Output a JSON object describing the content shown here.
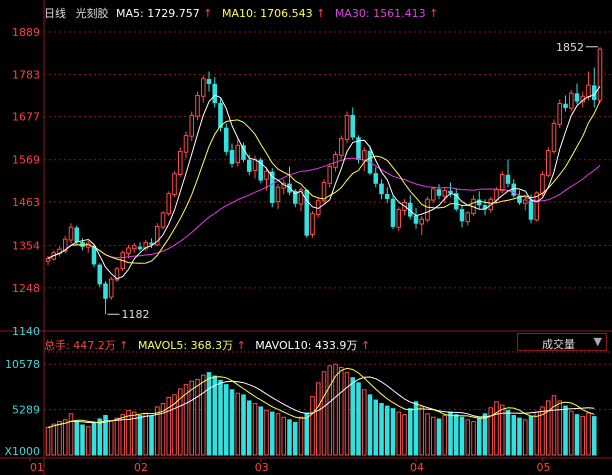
{
  "header": {
    "period": "日线",
    "name": "光刻胶",
    "ma5_label": "MA5:",
    "ma5_value": "1729.757",
    "ma10_label": "MA10:",
    "ma10_value": "1706.543",
    "ma30_label": "MA30:",
    "ma30_value": "1561.413",
    "up_arrow": "↑"
  },
  "volume_header": {
    "total_label": "总手:",
    "total_value": "447.2万",
    "mavol5_label": "MAVOL5:",
    "mavol5_value": "368.3万",
    "mavol10_label": "MAVOL10:",
    "mavol10_value": "433.9万",
    "up_arrow": "↑"
  },
  "indicator_select": {
    "selected": "成交量",
    "icon": "triangle-down-icon"
  },
  "colors": {
    "up": "#ff4a4a",
    "down": "#33e0e0",
    "ma5": "#ffffff",
    "ma10": "#ffff55",
    "ma30": "#e040e0",
    "axis": "#8b1a1a",
    "label_up": "#ff4040",
    "label_down": "#40d8d8"
  },
  "chart_data": [
    {
      "type": "candlestick",
      "title": "光刻胶",
      "x_ticks": [
        "01",
        "02",
        "03",
        "04",
        "05"
      ],
      "y_ticks": [
        "1140",
        "1248",
        "1354",
        "1463",
        "1569",
        "1677",
        "1783",
        "1889"
      ],
      "ylim": [
        1140,
        1889
      ],
      "annotations": [
        {
          "label": "1852"
        },
        {
          "label": "1182"
        }
      ],
      "series": [
        {
          "name": "MA5"
        },
        {
          "name": "MA10"
        },
        {
          "name": "MA30"
        }
      ],
      "candles": [
        [
          1315,
          1328,
          1305,
          1322
        ],
        [
          1320,
          1342,
          1316,
          1336
        ],
        [
          1334,
          1352,
          1326,
          1345
        ],
        [
          1340,
          1378,
          1334,
          1370
        ],
        [
          1368,
          1410,
          1360,
          1400
        ],
        [
          1398,
          1404,
          1358,
          1364
        ],
        [
          1362,
          1372,
          1342,
          1352
        ],
        [
          1350,
          1366,
          1336,
          1360
        ],
        [
          1352,
          1358,
          1300,
          1308
        ],
        [
          1305,
          1310,
          1250,
          1258
        ],
        [
          1258,
          1265,
          1182,
          1222
        ],
        [
          1225,
          1276,
          1218,
          1270
        ],
        [
          1268,
          1300,
          1262,
          1296
        ],
        [
          1296,
          1342,
          1290,
          1336
        ],
        [
          1334,
          1356,
          1322,
          1348
        ],
        [
          1346,
          1360,
          1336,
          1354
        ],
        [
          1350,
          1362,
          1340,
          1346
        ],
        [
          1346,
          1368,
          1340,
          1362
        ],
        [
          1360,
          1372,
          1348,
          1358
        ],
        [
          1356,
          1410,
          1352,
          1402
        ],
        [
          1400,
          1440,
          1394,
          1436
        ],
        [
          1434,
          1490,
          1428,
          1484
        ],
        [
          1482,
          1540,
          1476,
          1534
        ],
        [
          1532,
          1600,
          1526,
          1590
        ],
        [
          1588,
          1640,
          1572,
          1630
        ],
        [
          1628,
          1690,
          1616,
          1680
        ],
        [
          1678,
          1740,
          1668,
          1730
        ],
        [
          1728,
          1780,
          1712,
          1772
        ],
        [
          1770,
          1790,
          1740,
          1760
        ],
        [
          1758,
          1776,
          1700,
          1712
        ],
        [
          1710,
          1722,
          1640,
          1650
        ],
        [
          1648,
          1660,
          1580,
          1590
        ],
        [
          1592,
          1610,
          1550,
          1560
        ],
        [
          1562,
          1620,
          1552,
          1605
        ],
        [
          1604,
          1612,
          1562,
          1570
        ],
        [
          1568,
          1582,
          1530,
          1540
        ],
        [
          1542,
          1580,
          1522,
          1570
        ],
        [
          1568,
          1574,
          1510,
          1518
        ],
        [
          1520,
          1550,
          1492,
          1540
        ],
        [
          1538,
          1548,
          1450,
          1462
        ],
        [
          1464,
          1508,
          1446,
          1500
        ],
        [
          1498,
          1520,
          1482,
          1510
        ],
        [
          1508,
          1552,
          1480,
          1488
        ],
        [
          1490,
          1496,
          1450,
          1460
        ],
        [
          1458,
          1500,
          1440,
          1494
        ],
        [
          1492,
          1496,
          1374,
          1380
        ],
        [
          1382,
          1440,
          1374,
          1434
        ],
        [
          1432,
          1472,
          1424,
          1466
        ],
        [
          1466,
          1520,
          1460,
          1512
        ],
        [
          1510,
          1560,
          1500,
          1552
        ],
        [
          1550,
          1590,
          1540,
          1582
        ],
        [
          1580,
          1630,
          1570,
          1622
        ],
        [
          1620,
          1690,
          1610,
          1680
        ],
        [
          1680,
          1700,
          1618,
          1626
        ],
        [
          1624,
          1630,
          1560,
          1570
        ],
        [
          1568,
          1600,
          1540,
          1592
        ],
        [
          1590,
          1604,
          1530,
          1536
        ],
        [
          1534,
          1550,
          1500,
          1510
        ],
        [
          1508,
          1520,
          1470,
          1484
        ],
        [
          1482,
          1500,
          1460,
          1472
        ],
        [
          1470,
          1478,
          1395,
          1402
        ],
        [
          1400,
          1450,
          1390,
          1444
        ],
        [
          1442,
          1470,
          1430,
          1462
        ],
        [
          1460,
          1480,
          1420,
          1428
        ],
        [
          1428,
          1448,
          1396,
          1410
        ],
        [
          1408,
          1428,
          1380,
          1420
        ],
        [
          1418,
          1476,
          1412,
          1470
        ],
        [
          1468,
          1502,
          1460,
          1496
        ],
        [
          1494,
          1508,
          1470,
          1480
        ],
        [
          1478,
          1500,
          1460,
          1492
        ],
        [
          1490,
          1512,
          1476,
          1486
        ],
        [
          1484,
          1496,
          1440,
          1446
        ],
        [
          1444,
          1456,
          1400,
          1416
        ],
        [
          1414,
          1440,
          1404,
          1436
        ],
        [
          1434,
          1480,
          1428,
          1470
        ],
        [
          1468,
          1490,
          1446,
          1456
        ],
        [
          1454,
          1470,
          1430,
          1446
        ],
        [
          1444,
          1476,
          1436,
          1470
        ],
        [
          1468,
          1500,
          1460,
          1494
        ],
        [
          1492,
          1540,
          1486,
          1532
        ],
        [
          1530,
          1570,
          1500,
          1510
        ],
        [
          1508,
          1520,
          1474,
          1480
        ],
        [
          1478,
          1492,
          1456,
          1462
        ],
        [
          1460,
          1476,
          1442,
          1468
        ],
        [
          1466,
          1482,
          1410,
          1420
        ],
        [
          1418,
          1490,
          1414,
          1486
        ],
        [
          1484,
          1540,
          1478,
          1532
        ],
        [
          1530,
          1600,
          1524,
          1592
        ],
        [
          1590,
          1670,
          1584,
          1660
        ],
        [
          1658,
          1720,
          1648,
          1710
        ],
        [
          1708,
          1730,
          1690,
          1700
        ],
        [
          1698,
          1744,
          1690,
          1736
        ],
        [
          1734,
          1760,
          1708,
          1716
        ],
        [
          1714,
          1740,
          1700,
          1728
        ],
        [
          1726,
          1790,
          1718,
          1756
        ],
        [
          1754,
          1800,
          1700,
          1720
        ],
        [
          1718,
          1852,
          1712,
          1846
        ]
      ]
    },
    {
      "type": "bar",
      "title": "成交量",
      "unit_label": "X1000",
      "y_ticks": [
        "10578",
        "5289"
      ],
      "ylim": [
        0,
        12000
      ],
      "series": [
        {
          "name": "MAVOL5"
        },
        {
          "name": "MAVOL10"
        }
      ],
      "values": [
        3200,
        3600,
        3900,
        4100,
        4800,
        3900,
        3500,
        3300,
        3700,
        4200,
        4600,
        4000,
        4300,
        4700,
        5200,
        5000,
        4600,
        4800,
        4500,
        5600,
        6000,
        6700,
        7000,
        7700,
        8200,
        8600,
        8800,
        9300,
        9600,
        9200,
        8700,
        8200,
        7600,
        7200,
        7000,
        6300,
        6000,
        5600,
        5200,
        5000,
        4800,
        4400,
        4100,
        3800,
        4400,
        4900,
        6800,
        8400,
        9700,
        10400,
        10578,
        10200,
        9600,
        9000,
        8400,
        7600,
        7000,
        6400,
        6000,
        5700,
        5400,
        5000,
        4700,
        5400,
        6200,
        5600,
        4800,
        4400,
        4200,
        4600,
        5000,
        4700,
        4400,
        4100,
        3900,
        4300,
        4800,
        5500,
        6200,
        5800,
        5200,
        4600,
        4300,
        4100,
        4500,
        5000,
        5600,
        6300,
        6900,
        6300,
        5700,
        5100,
        4700,
        4500,
        4900,
        4472
      ]
    }
  ]
}
